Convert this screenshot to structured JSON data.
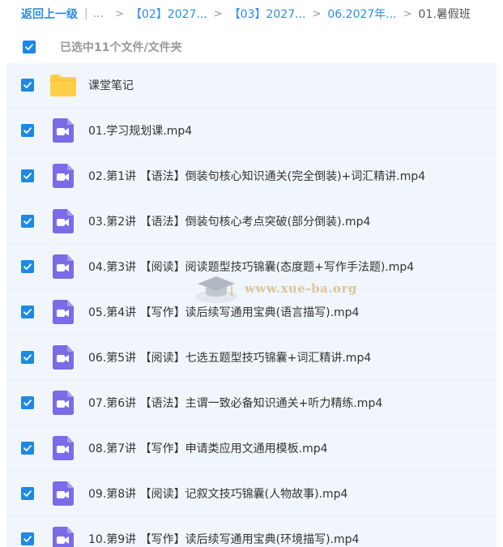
{
  "breadcrumb": {
    "back_label": "返回上一级",
    "pipe": "|",
    "ellipsis": "...",
    "items": [
      "【02】2027...",
      "【03】2027...",
      "06.2027年..."
    ],
    "current": "01.暑假班",
    "separator": ">"
  },
  "selection": {
    "status_text": "已选中11个文件/文件夹",
    "checked": true
  },
  "colors": {
    "accent": "#1e88e5",
    "link": "#2c8ce6",
    "folder": "#ffcf4a",
    "video_icon": "#7c6be6",
    "list_bg": "#f1f6fc"
  },
  "files": [
    {
      "name": "课堂笔记",
      "type": "folder",
      "icon": "folder-icon",
      "checked": true
    },
    {
      "name": "01.学习规划课.mp4",
      "type": "video",
      "icon": "video-file-icon",
      "checked": true
    },
    {
      "name": "02.第1讲 【语法】倒装句核心知识通关(完全倒装)+词汇精讲.mp4",
      "type": "video",
      "icon": "video-file-icon",
      "checked": true
    },
    {
      "name": "03.第2讲 【语法】倒装句核心考点突破(部分倒装).mp4",
      "type": "video",
      "icon": "video-file-icon",
      "checked": true
    },
    {
      "name": "04.第3讲 【阅读】阅读题型技巧锦囊(态度题+写作手法题).mp4",
      "type": "video",
      "icon": "video-file-icon",
      "checked": true
    },
    {
      "name": "05.第4讲 【写作】读后续写通用宝典(语言描写).mp4",
      "type": "video",
      "icon": "video-file-icon",
      "checked": true
    },
    {
      "name": "06.第5讲 【阅读】七选五题型技巧锦囊+词汇精讲.mp4",
      "type": "video",
      "icon": "video-file-icon",
      "checked": true
    },
    {
      "name": "07.第6讲 【语法】主谓一致必备知识通关+听力精练.mp4",
      "type": "video",
      "icon": "video-file-icon",
      "checked": true
    },
    {
      "name": "08.第7讲 【写作】申请类应用文通用模板.mp4",
      "type": "video",
      "icon": "video-file-icon",
      "checked": true
    },
    {
      "name": "09.第8讲 【阅读】记叙文技巧锦囊(人物故事).mp4",
      "type": "video",
      "icon": "video-file-icon",
      "checked": true
    },
    {
      "name": "10.第9讲 【写作】读后续写通用宝典(环境描写).mp4",
      "type": "video",
      "icon": "video-file-icon",
      "checked": true
    }
  ],
  "watermark": {
    "text": "www.xue-ba.org",
    "icon": "graduation-cap-logo"
  }
}
